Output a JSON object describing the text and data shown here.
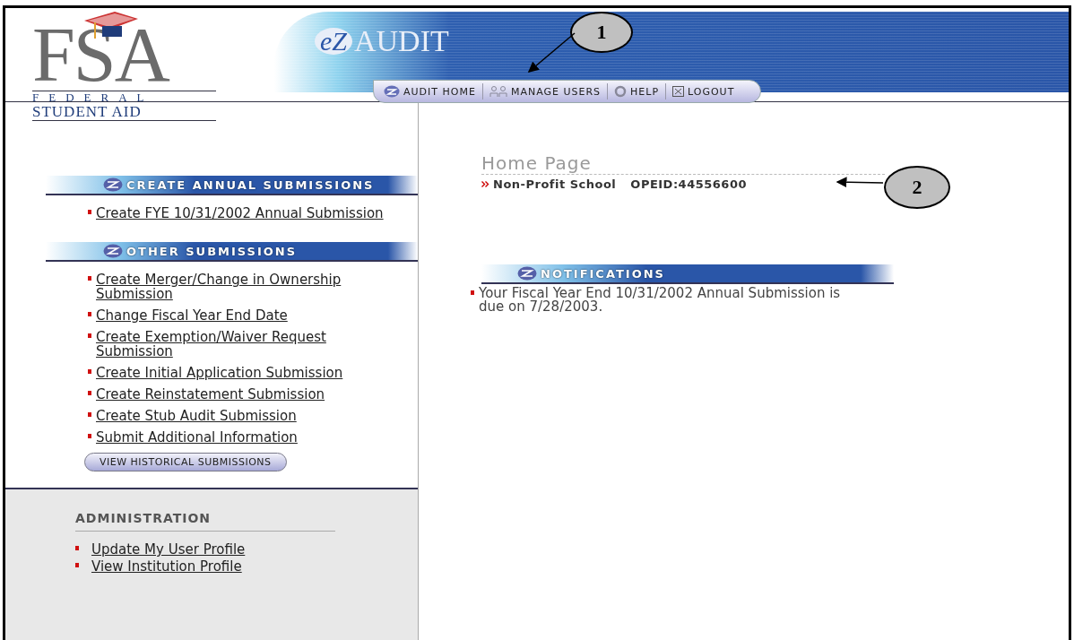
{
  "logo": {
    "letters": "FSA",
    "line1": "FEDERAL",
    "line2": "STUDENT AID"
  },
  "app": {
    "prefix": "eZ",
    "title": "AUDIT"
  },
  "nav": [
    {
      "label": "AUDIT HOME",
      "kind": "ez"
    },
    {
      "label": "MANAGE USERS",
      "kind": "users"
    },
    {
      "label": "HELP",
      "kind": "help"
    },
    {
      "label": "LOGOUT",
      "kind": "logout"
    }
  ],
  "sidebar": {
    "sections": [
      {
        "title": "CREATE ANNUAL SUBMISSIONS",
        "links": [
          "Create FYE 10/31/2002 Annual Submission"
        ]
      },
      {
        "title": "OTHER SUBMISSIONS",
        "links": [
          "Create Merger/Change in Ownership Submission",
          "Change Fiscal Year End Date",
          "Create Exemption/Waiver Request Submission",
          "Create Initial Application Submission",
          "Create Reinstatement Submission",
          "Create Stub Audit Submission",
          "Submit Additional Information"
        ]
      }
    ],
    "button": "VIEW HISTORICAL SUBMISSIONS",
    "admin": {
      "title": "ADMINISTRATION",
      "links": [
        "Update My User Profile",
        "View Institution Profile"
      ]
    }
  },
  "main": {
    "page_title": "Home Page",
    "school": "Non-Profit School",
    "opeid": "OPEID:44556600",
    "notifications": {
      "title": "NOTIFICATIONS",
      "items": [
        "Your Fiscal Year End 10/31/2002 Annual Submission is due on 7/28/2003."
      ]
    }
  },
  "callouts": [
    {
      "number": "1"
    },
    {
      "number": "2"
    }
  ]
}
